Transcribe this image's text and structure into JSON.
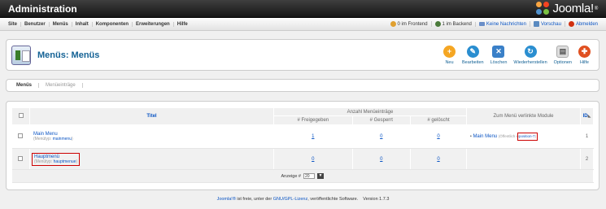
{
  "header": {
    "title": "Administration",
    "logo": "Joomla!"
  },
  "menubar": {
    "items": [
      "Site",
      "Benutzer",
      "Menüs",
      "Inhalt",
      "Komponenten",
      "Erweiterungen",
      "Hilfe"
    ],
    "status": {
      "frontend": "0 im Frontend",
      "backend": "1 im Backend",
      "messages": "Keine Nachrichten",
      "preview": "Vorschau",
      "logout": "Abmelden"
    }
  },
  "toolbar": {
    "page_title": "Menüs: Menüs",
    "new": "Neu",
    "edit": "Bearbeiten",
    "delete": "Löschen",
    "restore": "Wiederherstellen",
    "options": "Optionen",
    "help": "Hilfe"
  },
  "submenu": {
    "tab1": "Menüs",
    "tab2": "Menüeinträge"
  },
  "table": {
    "col_title": "Titel",
    "col_group": "Anzahl Menüeinträge",
    "col_published": "# Freigegeben",
    "col_locked": "# Gesperrt",
    "col_deleted": "# gelöscht",
    "col_modules": "Zum Menü verlinkte Module",
    "col_id": "ID",
    "rows": [
      {
        "name": "Main Menu",
        "type_label": "(Menütyp:",
        "type": "mainmenu",
        "type_close": ")",
        "published": "1",
        "locked": "0",
        "deleted": "0",
        "module": "Main Menu",
        "module_pre": "(Öffentlich in",
        "module_pos": "position-7",
        "module_post": ")",
        "id": "1"
      },
      {
        "name": "Hauptmenü",
        "type_label": "(Menütyp:",
        "type": "hauptmenue",
        "type_close": ")",
        "published": "0",
        "locked": "0",
        "deleted": "0",
        "id": "2"
      }
    ],
    "limit_label": "Anzeige #",
    "limit_value": "20"
  },
  "footer": {
    "joomla": "Joomla!®",
    "text1": " ist freie, unter der ",
    "license": "GNU/GPL-Lizenz",
    "text2": ", veröffentlichte Software.    Version 1.7.3"
  },
  "colors": {
    "accent": "#146295",
    "link": "#0b55c4",
    "highlight": "#cc0000"
  }
}
